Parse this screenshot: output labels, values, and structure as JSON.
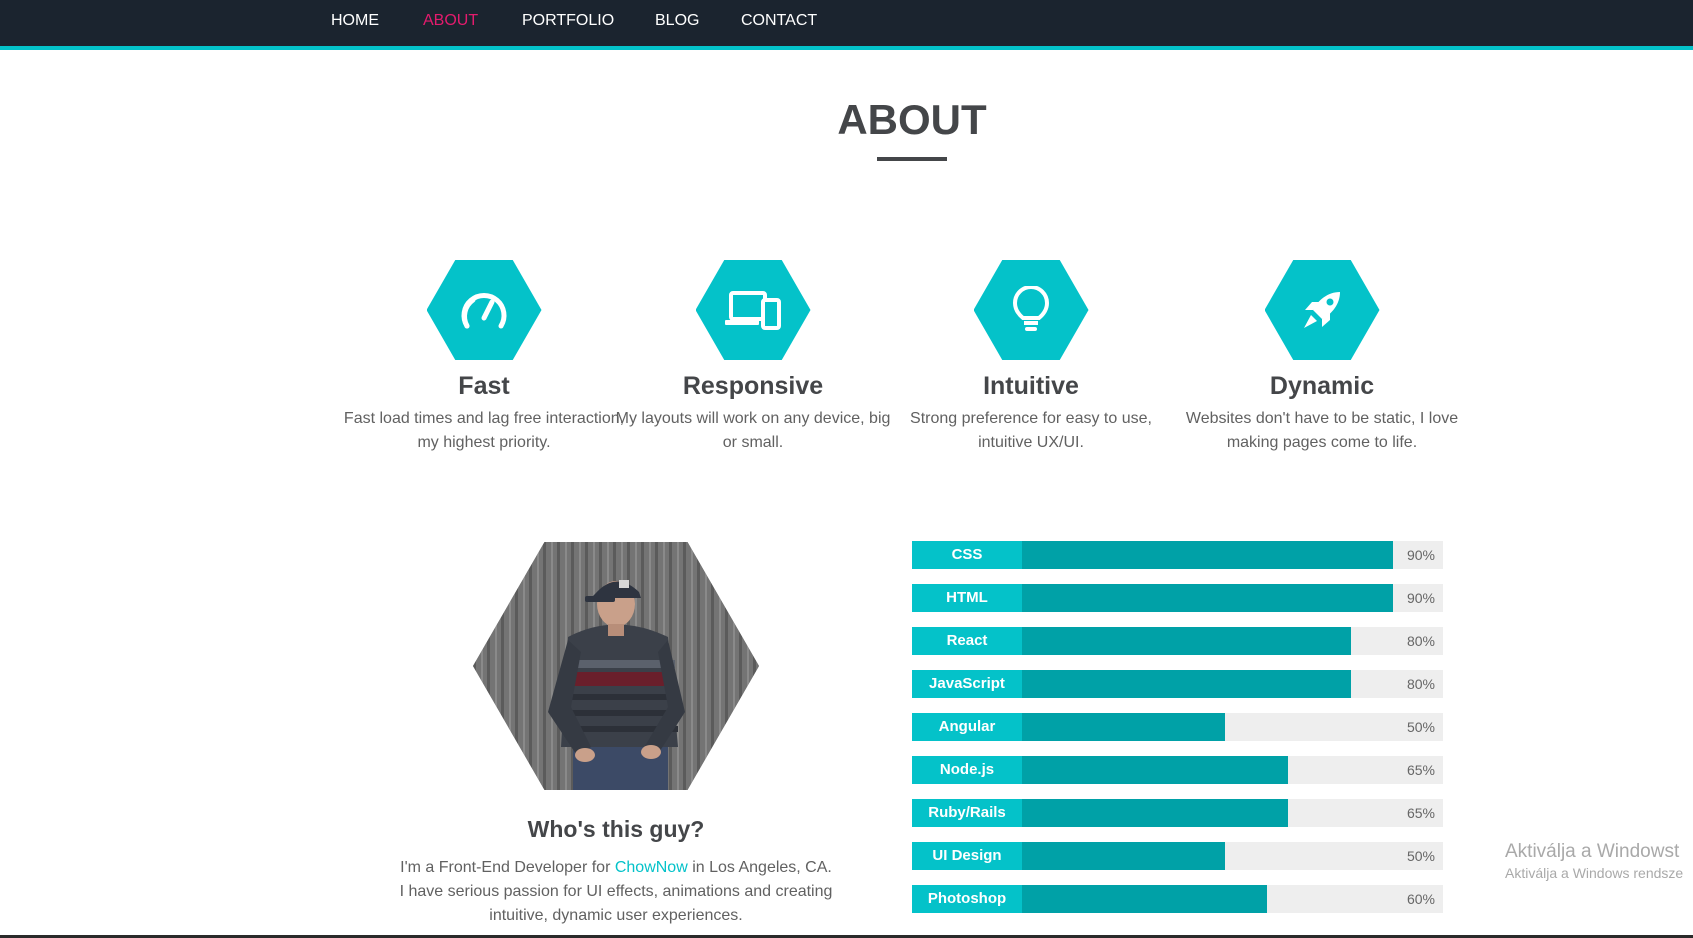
{
  "nav": {
    "items": [
      {
        "label": "HOME",
        "active": false
      },
      {
        "label": "ABOUT",
        "active": true
      },
      {
        "label": "PORTFOLIO",
        "active": false
      },
      {
        "label": "BLOG",
        "active": false
      },
      {
        "label": "CONTACT",
        "active": false
      }
    ]
  },
  "section": {
    "title": "ABOUT"
  },
  "features": [
    {
      "icon": "speedometer-icon",
      "title": "Fast",
      "desc": "Fast load times and lag free interaction, my highest priority."
    },
    {
      "icon": "devices-icon",
      "title": "Responsive",
      "desc": "My layouts will work on any device, big or small."
    },
    {
      "icon": "lightbulb-icon",
      "title": "Intuitive",
      "desc": "Strong preference for easy to use, intuitive UX/UI."
    },
    {
      "icon": "rocket-icon",
      "title": "Dynamic",
      "desc": "Websites don't have to be static, I love making pages come to life."
    }
  ],
  "profile": {
    "title": "Who's this guy?",
    "bio_prefix": "I'm a Front-End Developer for ",
    "bio_link": "ChowNow",
    "bio_suffix": " in Los Angeles, CA.",
    "bio_line2": "I have serious passion for UI effects, animations and creating",
    "bio_line3": "intuitive, dynamic user experiences."
  },
  "skills": [
    {
      "name": "CSS",
      "value": 90,
      "label": "90%"
    },
    {
      "name": "HTML",
      "value": 90,
      "label": "90%"
    },
    {
      "name": "React",
      "value": 80,
      "label": "80%"
    },
    {
      "name": "JavaScript",
      "value": 80,
      "label": "80%"
    },
    {
      "name": "Angular",
      "value": 50,
      "label": "50%"
    },
    {
      "name": "Node.js",
      "value": 65,
      "label": "65%"
    },
    {
      "name": "Ruby/Rails",
      "value": 65,
      "label": "65%"
    },
    {
      "name": "UI Design",
      "value": 50,
      "label": "50%"
    },
    {
      "name": "Photoshop",
      "value": 60,
      "label": "60%"
    }
  ],
  "watermark": {
    "line1": "Aktiválja a Windowst",
    "line2": "Aktiválja a Windows rendsze"
  },
  "colors": {
    "nav_bg": "#1b242f",
    "accent": "#04c2c9",
    "accent_dark": "#00a1a7",
    "active_link": "#e31b6d"
  }
}
